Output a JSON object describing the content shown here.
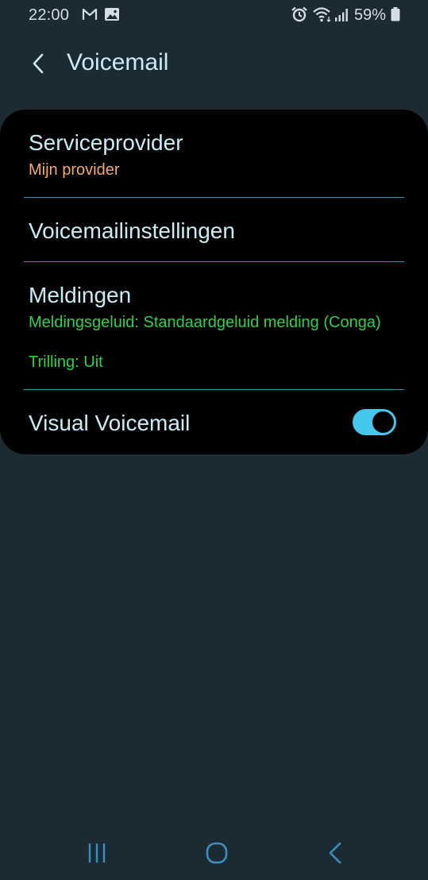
{
  "status_bar": {
    "time": "22:00",
    "battery_percent": "59%",
    "icons": [
      "gmail-icon",
      "image-icon",
      "alarm-icon",
      "wifi-icon",
      "signal-icon",
      "battery-icon"
    ]
  },
  "header": {
    "title": "Voicemail",
    "back_icon": "chevron-left-icon"
  },
  "settings": {
    "service_provider": {
      "title": "Serviceprovider",
      "value": "Mijn provider"
    },
    "voicemail_settings": {
      "title": "Voicemailinstellingen"
    },
    "notifications": {
      "title": "Meldingen",
      "sound": "Meldingsgeluid: Standaardgeluid melding (Conga)",
      "vibration": "Trilling: Uit"
    },
    "visual_voicemail": {
      "title": "Visual Voicemail",
      "enabled": true
    }
  },
  "colors": {
    "background": "#1c2b33",
    "card": "#000000",
    "accent": "#45c6ec",
    "provider_value": "#f5a96a",
    "notification_value": "#31d04a",
    "divider": "#3e94a6"
  },
  "nav_bar": {
    "icons": [
      "recents-icon",
      "home-icon",
      "back-icon"
    ]
  }
}
